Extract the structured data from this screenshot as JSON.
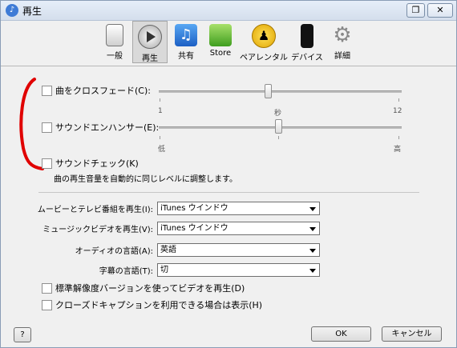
{
  "window": {
    "title": "再生",
    "help_label": "❐",
    "close_label": "✕"
  },
  "toolbar": {
    "items": [
      {
        "label": "一般",
        "icon": "switch-icon"
      },
      {
        "label": "再生",
        "icon": "play-icon"
      },
      {
        "label": "共有",
        "icon": "music-note-icon"
      },
      {
        "label": "Store",
        "icon": "shopping-bag-icon"
      },
      {
        "label": "ペアレンタル",
        "icon": "parental-icon"
      },
      {
        "label": "デバイス",
        "icon": "iphone-icon"
      },
      {
        "label": "詳細",
        "icon": "gear-icon"
      }
    ]
  },
  "crossfade": {
    "label": "曲をクロスフェード(C):",
    "min": "1",
    "unit": "秒",
    "max": "12"
  },
  "sound_enhancer": {
    "label": "サウンドエンハンサー(E):",
    "low": "低",
    "high": "高"
  },
  "sound_check": {
    "label": "サウンドチェック(K)",
    "description": "曲の再生音量を自動的に同じレベルに調整します。"
  },
  "movies": {
    "label": "ムービーとテレビ番組を再生(I):",
    "value": "iTunes ウインドウ"
  },
  "music_video": {
    "label": "ミュージックビデオを再生(V):",
    "value": "iTunes ウインドウ"
  },
  "audio_language": {
    "label": "オーディオの言語(A):",
    "value": "英語"
  },
  "subtitle_language": {
    "label": "字幕の言語(T):",
    "value": "切"
  },
  "standard_definition": {
    "label": "標準解像度バージョンを使ってビデオを再生(D)"
  },
  "closed_caption": {
    "label": "クローズドキャプションを利用できる場合は表示(H)"
  },
  "bottom": {
    "help": "?",
    "ok": "OK",
    "cancel": "キャンセル"
  },
  "annotation": {
    "color": "#e00000"
  }
}
